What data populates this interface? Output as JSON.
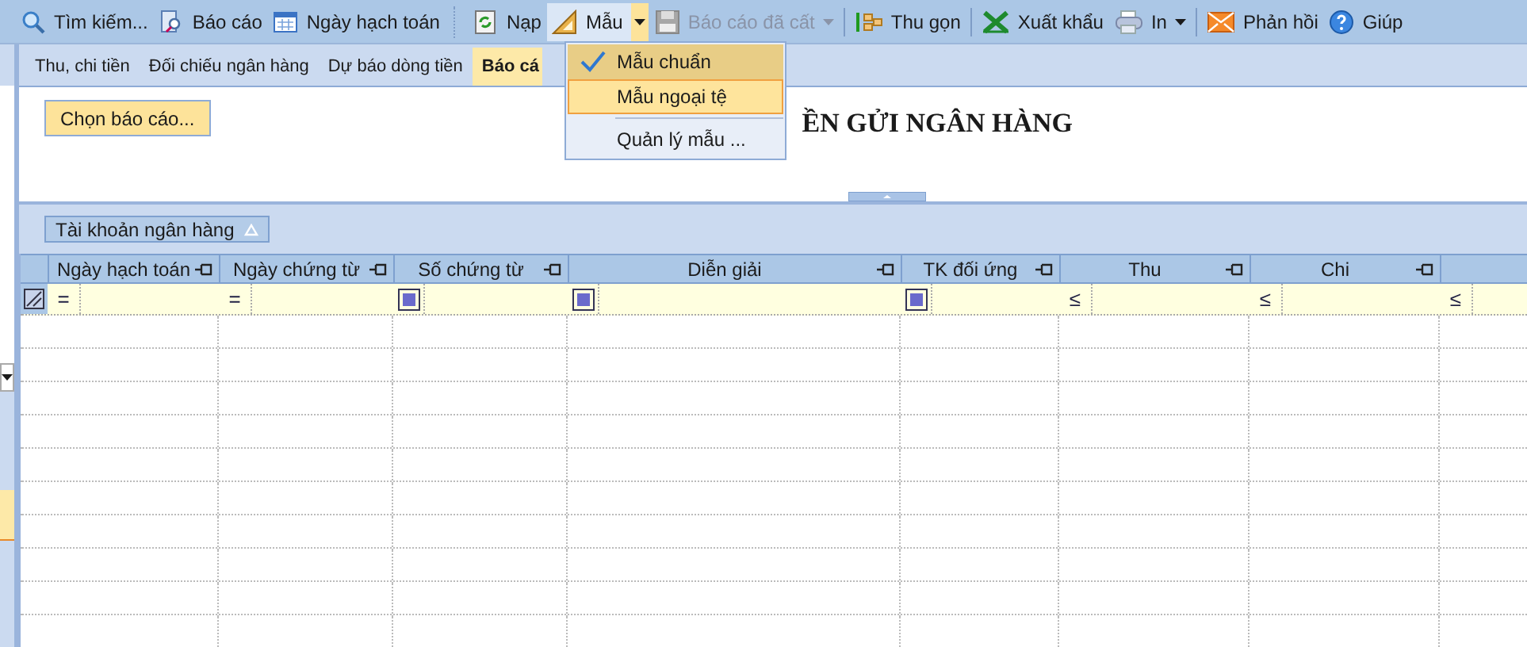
{
  "toolbar": {
    "items": [
      {
        "kind": "button",
        "label": "Tìm kiếm...",
        "disabled": false,
        "pressed": false,
        "dropdown": false
      },
      {
        "kind": "button",
        "label": "Báo cáo",
        "disabled": false,
        "pressed": false,
        "dropdown": false
      },
      {
        "kind": "button",
        "label": "Ngày hạch toán",
        "disabled": false,
        "pressed": false,
        "dropdown": false
      },
      {
        "kind": "grip"
      },
      {
        "kind": "button",
        "label": "Nạp",
        "disabled": false,
        "pressed": false,
        "dropdown": false
      },
      {
        "kind": "button",
        "label": "Mẫu",
        "disabled": false,
        "pressed": true,
        "dropdown": true
      },
      {
        "kind": "button",
        "label": "Báo cáo đã cất",
        "disabled": true,
        "pressed": false,
        "dropdown": true
      },
      {
        "kind": "separator"
      },
      {
        "kind": "button",
        "label": "Thu gọn",
        "disabled": false,
        "pressed": false,
        "dropdown": false
      },
      {
        "kind": "separator"
      },
      {
        "kind": "button",
        "label": "Xuất khẩu",
        "disabled": false,
        "pressed": false,
        "dropdown": false
      },
      {
        "kind": "button",
        "label": "In",
        "disabled": false,
        "pressed": false,
        "dropdown": true
      },
      {
        "kind": "separator"
      },
      {
        "kind": "button",
        "label": "Phản hồi",
        "disabled": false,
        "pressed": false,
        "dropdown": false
      },
      {
        "kind": "button",
        "label": "Giúp",
        "disabled": false,
        "pressed": false,
        "dropdown": false
      }
    ]
  },
  "tabs": [
    {
      "label": "Thu, chi tiền",
      "selected": false
    },
    {
      "label": "Đối chiếu ngân hàng",
      "selected": false
    },
    {
      "label": "Dự báo dòng tiền",
      "selected": false
    },
    {
      "label": "Báo cá",
      "selected": true
    }
  ],
  "template_menu": {
    "items": [
      {
        "kind": "item",
        "label": "Mẫu chuẩn",
        "checked": true,
        "selected": false
      },
      {
        "kind": "item",
        "label": "Mẫu ngoại tệ",
        "checked": false,
        "selected": true
      },
      {
        "kind": "separator"
      },
      {
        "kind": "item",
        "label": "Quản lý mẫu ...",
        "checked": false,
        "selected": false
      }
    ]
  },
  "choose_report_button": "Chọn báo cáo...",
  "report_title": "ỀN GỬI NGÂN HÀNG",
  "group_panel": {
    "label": "Tài khoản ngân hàng"
  },
  "table": {
    "columns": [
      {
        "kind": "operator",
        "label": "Ngày hạch toán",
        "filter": "="
      },
      {
        "kind": "operator",
        "label": "Ngày chứng từ",
        "filter": "="
      },
      {
        "kind": "square",
        "label": "Số chứng từ"
      },
      {
        "kind": "square",
        "label": "Diễn giải"
      },
      {
        "kind": "square",
        "label": "TK đối ứng"
      },
      {
        "kind": "operator",
        "label": "Thu",
        "filter": "≤"
      },
      {
        "kind": "operator",
        "label": "Chi",
        "filter": "≤"
      },
      {
        "kind": "operator",
        "filter": "≤"
      }
    ]
  }
}
